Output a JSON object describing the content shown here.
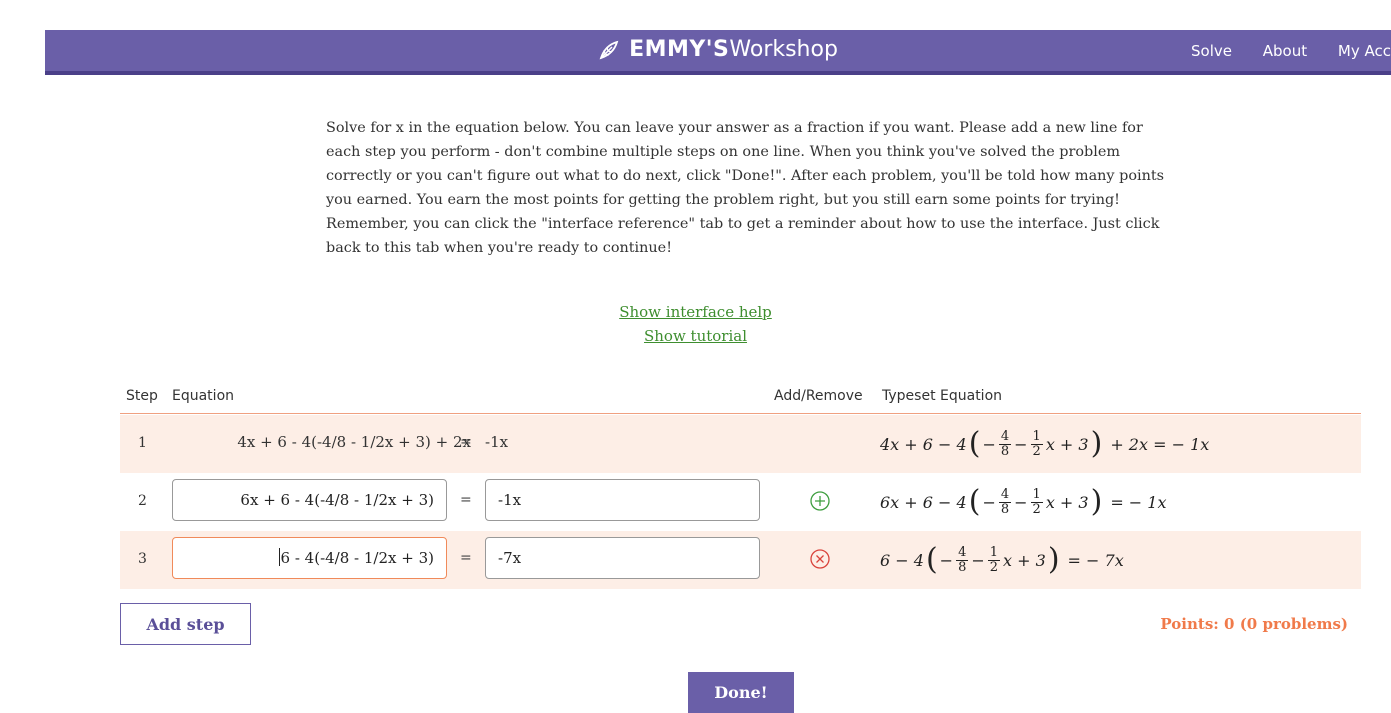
{
  "header": {
    "brand_bold": "EMMY'S",
    "brand_light": "Workshop",
    "nav": [
      "Solve",
      "About",
      "My Acc"
    ]
  },
  "instructions": "Solve for x in the equation below. You can leave your answer as a fraction if you want. Please add a new line for each step you perform - don't combine multiple steps on one line. When you think you've solved the problem correctly or you can't figure out what to do next, click \"Done!\". After each problem, you'll be told how many points you earned. You earn the most points for getting the problem right, but you still earn some points for trying! Remember, you can click the \"interface reference\" tab to get a reminder about how to use the interface. Just click back to this tab when you're ready to continue!",
  "links": {
    "help": "Show interface help",
    "tutorial": "Show tutorial"
  },
  "table": {
    "headers": {
      "step": "Step",
      "equation": "Equation",
      "addremove": "Add/Remove",
      "typeset": "Typeset Equation"
    },
    "rows": [
      {
        "step": "1",
        "lhs": "4x + 6 - 4(-4/8 - 1/2x + 3) + 2x",
        "eq": "=",
        "rhs": "-1x"
      },
      {
        "step": "2",
        "lhs": "6x + 6 - 4(-4/8 - 1/2x + 3)",
        "eq": "=",
        "rhs": "-1x"
      },
      {
        "step": "3",
        "lhs": "6 - 4(-4/8 - 1/2x + 3)",
        "eq": "=",
        "rhs": "-7x"
      }
    ],
    "typeset": {
      "row1_pre": "4x + 6 − 4",
      "row1_post": "+ 2x = − 1x",
      "row2_pre": "6x + 6 − 4",
      "row2_post": "= − 1x",
      "row3_pre": "6 − 4",
      "row3_post": "= − 7x",
      "frac1_n": "4",
      "frac1_d": "8",
      "frac2_n": "1",
      "frac2_d": "2",
      "minus": "−",
      "minus2": "−",
      "xplus3": "x + 3"
    }
  },
  "buttons": {
    "add_step": "Add step",
    "done": "Done!"
  },
  "points": "Points: 0 (0 problems)",
  "colors": {
    "header": "#6a5fa8",
    "accent": "#f07a4a",
    "add_icon": "#3e9e3f",
    "remove_icon": "#d9443c",
    "link": "#3e8e2f"
  },
  "icons": {
    "add": "plus-circle-icon",
    "remove": "x-circle-icon",
    "logo": "leaf-icon"
  }
}
